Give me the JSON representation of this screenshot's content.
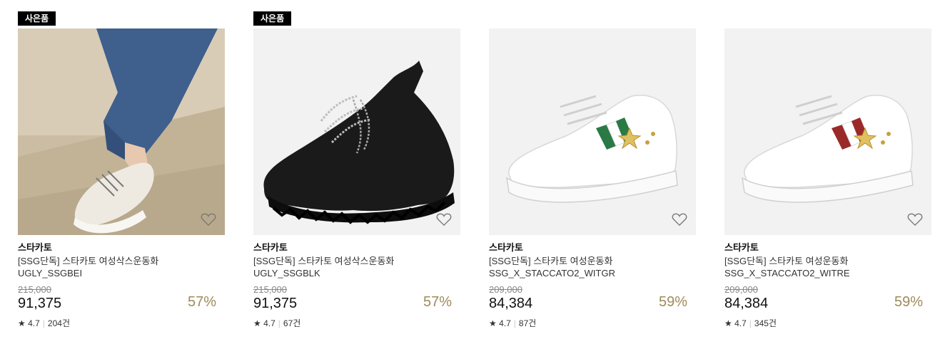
{
  "products": [
    {
      "badge": "사은품",
      "brand": "스타카토",
      "name": "[SSG단독] 스타카토 여성삭스운동화",
      "code": "UGLY_SSGBEI",
      "original_price": "215,000",
      "price": "91,375",
      "discount": "57%",
      "star": "★",
      "rating": "4.7",
      "reviews": "204건"
    },
    {
      "badge": "사은품",
      "brand": "스타카토",
      "name": "[SSG단독] 스타카토 여성삭스운동화",
      "code": "UGLY_SSGBLK",
      "original_price": "215,000",
      "price": "91,375",
      "discount": "57%",
      "star": "★",
      "rating": "4.7",
      "reviews": "67건"
    },
    {
      "badge": "",
      "brand": "스타카토",
      "name": "[SSG단독] 스타카토 여성운동화",
      "code": "SSG_X_STACCATO2_WITGR",
      "original_price": "209,000",
      "price": "84,384",
      "discount": "59%",
      "star": "★",
      "rating": "4.7",
      "reviews": "87건"
    },
    {
      "badge": "",
      "brand": "스타카토",
      "name": "[SSG단독] 스타카토 여성운동화",
      "code": "SSG_X_STACCATO2_WITRE",
      "original_price": "209,000",
      "price": "84,384",
      "discount": "59%",
      "star": "★",
      "rating": "4.7",
      "reviews": "345건"
    }
  ],
  "colors": {
    "discount": "#a08a5a",
    "badge_bg": "#000000"
  },
  "icons": {
    "wishlist": "heart-outline-icon",
    "rating": "star-icon"
  }
}
